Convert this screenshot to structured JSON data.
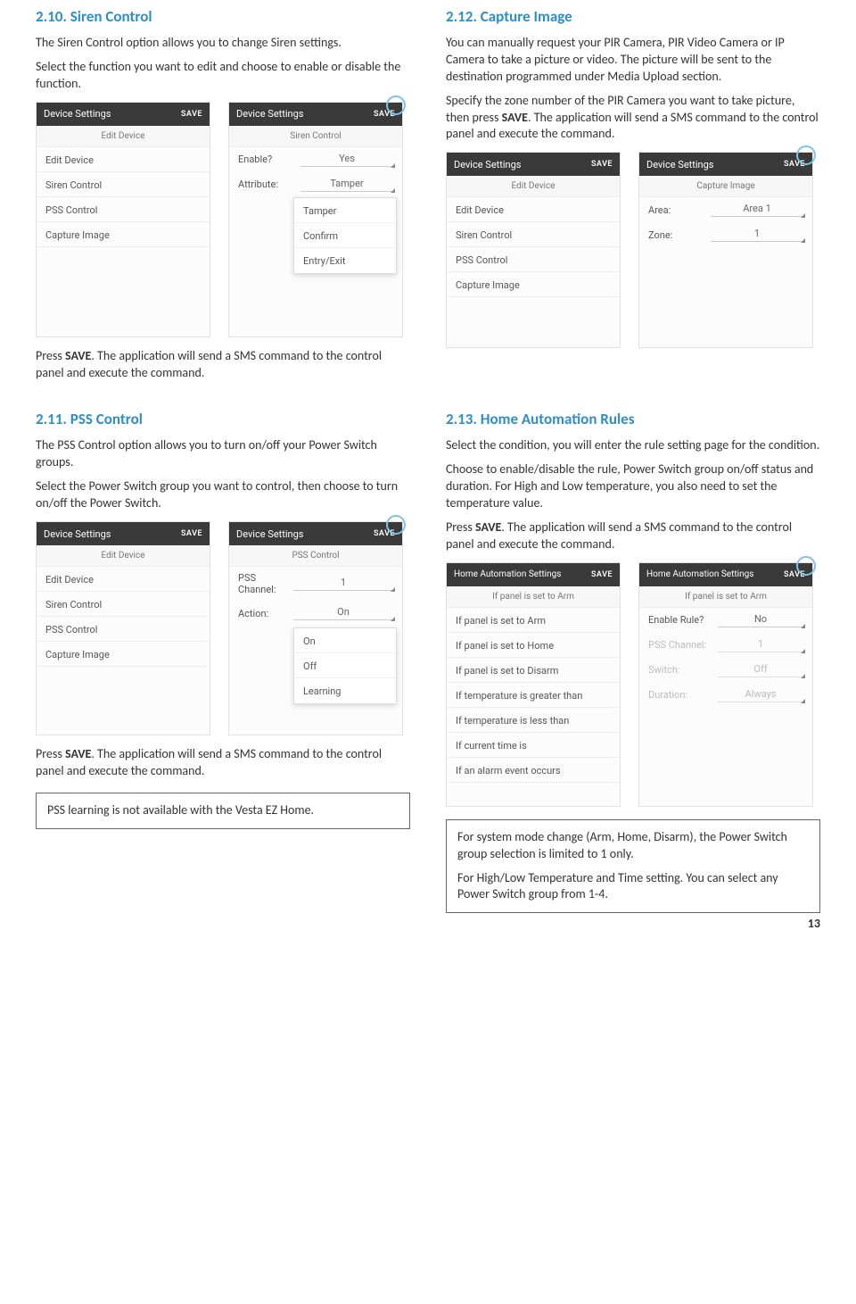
{
  "sec210": {
    "heading": "2.10. Siren Control",
    "p1": "The Siren Control option allows you to change Siren settings.",
    "p2": "Select the function you want to edit and choose to enable or disable the function.",
    "after1a": "Press ",
    "after1b": "SAVE",
    "after1c": ". The application will send a SMS command to the control panel and execute the command."
  },
  "sec211": {
    "heading": "2.11. PSS Control",
    "p1": "The PSS Control option allows you to turn on/off your Power Switch groups.",
    "p2": "Select the Power Switch group you want to control, then choose to turn on/off the Power Switch.",
    "after1a": "Press ",
    "after1b": "SAVE",
    "after1c": ". The application will send a SMS command to the control panel and execute the command.",
    "note": "PSS learning is not available with the Vesta EZ Home."
  },
  "sec212": {
    "heading": "2.12. Capture Image",
    "p1": "You can manually request your PIR Camera, PIR Video Camera or IP Camera to take a picture or video. The picture will be sent to the destination programmed under Media Upload section.",
    "p2a": "Specify the zone number of the PIR Camera you want to take picture, then press ",
    "p2b": "SAVE",
    "p2c": ". The application will send a SMS command to the control panel and execute the command."
  },
  "sec213": {
    "heading": "2.13. Home Automation Rules",
    "p1": "Select the condition, you will enter the rule setting page for the condition.",
    "p2": "Choose to enable/disable the rule, Power Switch group on/off status and duration. For High and Low temperature, you also need to set the temperature value.",
    "p3a": "Press ",
    "p3b": "SAVE",
    "p3c": ". The application will send a SMS command to the control panel and execute the command.",
    "note1": "For system mode change (Arm, Home, Disarm), the Power Switch group selection is limited to 1 only.",
    "note2": "For High/Low Temperature and Time setting. You can select any Power Switch group from 1-4."
  },
  "ui": {
    "device_settings": "Device Settings",
    "ha_settings": "Home Automation Settings",
    "save": "SAVE",
    "edit_device": "Edit Device",
    "siren_control": "Siren Control",
    "pss_control": "PSS Control",
    "capture_image": "Capture Image",
    "enable_q": "Enable?",
    "yes": "Yes",
    "attribute": "Attribute:",
    "tamper": "Tamper",
    "confirm": "Confirm",
    "entry_exit": "Entry/Exit",
    "pss_channel": "PSS Channel:",
    "one": "1",
    "action": "Action:",
    "on": "On",
    "off": "Off",
    "learning": "Learning",
    "area": "Area:",
    "area1": "Area 1",
    "zone": "Zone:",
    "if_panel_arm_sub": "If panel is set to Arm",
    "if_arm": "If panel is set to Arm",
    "if_home": "If panel is set to Home",
    "if_disarm": "If panel is set to Disarm",
    "if_temp_gt": "If temperature is greater than",
    "if_temp_lt": "If temperature is less than",
    "if_time": "If current time is",
    "if_alarm": "If an alarm event occurs",
    "enable_rule": "Enable Rule?",
    "no": "No",
    "switch": "Switch:",
    "duration": "Duration:",
    "always": "Always"
  },
  "page": "13"
}
